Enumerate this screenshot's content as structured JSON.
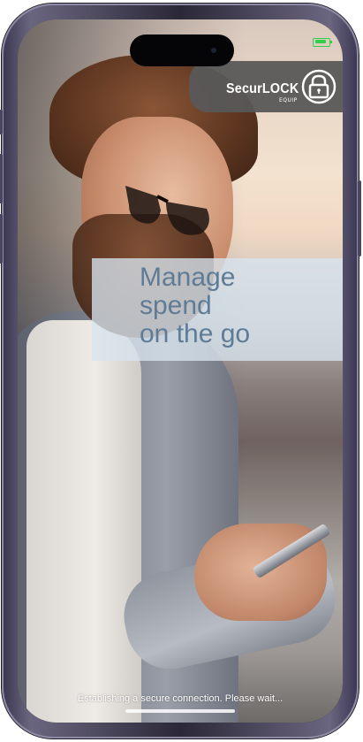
{
  "app": {
    "logo_text": "SecurLOCK",
    "logo_subtext": "EQUIP"
  },
  "tagline": {
    "line1": "Manage",
    "line2": "spend",
    "line3": "on the go"
  },
  "status": {
    "message": "Establishing a secure connection. Please wait..."
  },
  "icons": {
    "battery": "battery-icon",
    "lock": "lock-icon"
  },
  "colors": {
    "tagline": "#5f7b95",
    "badge": "#585858",
    "battery": "#2fd14b"
  }
}
